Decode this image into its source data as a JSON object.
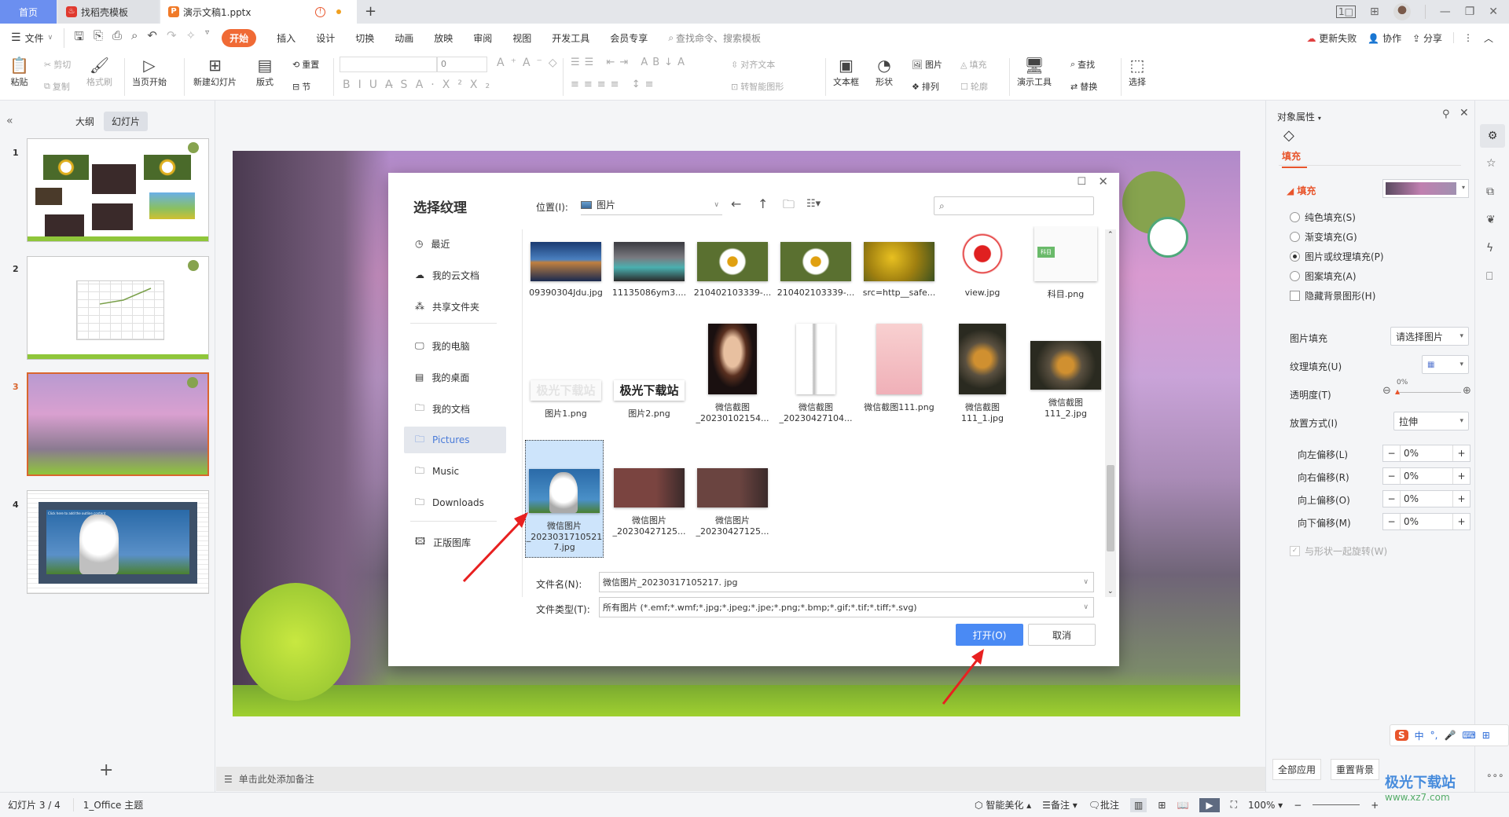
{
  "titlebar": {
    "tabs": [
      {
        "label": "首页"
      },
      {
        "label": "找稻壳模板",
        "icon": "daoke-logo-icon"
      },
      {
        "label": "演示文稿1.pptx",
        "icon": "pptx-file-icon",
        "status": "!"
      }
    ],
    "new_tab": "+",
    "win": {
      "layout": "1□",
      "grid": "⊞",
      "min": "—",
      "restore": "❐",
      "close": "✕"
    }
  },
  "menubar": {
    "file": "文件",
    "items": [
      "开始",
      "插入",
      "设计",
      "切换",
      "动画",
      "放映",
      "审阅",
      "视图",
      "开发工具",
      "会员专享"
    ],
    "search_placeholder": "查找命令、搜索模板",
    "right": {
      "update": "更新失败",
      "collab": "协作",
      "share": "分享"
    }
  },
  "ribbon": {
    "paste": "粘贴",
    "cut": "剪切",
    "copy": "复制",
    "format_painter": "格式刷",
    "from_current": "当页开始",
    "new_slide": "新建幻灯片",
    "layout": "版式",
    "reset": "重置",
    "section": "节",
    "font_size": "0",
    "align_text": "对齐文本",
    "smart_shape": "转智能图形",
    "textbox": "文本框",
    "shape": "形状",
    "picture": "图片",
    "fill": "填充",
    "arrange": "排列",
    "outline": "轮廓",
    "present_tools": "演示工具",
    "find": "查找",
    "replace": "替换",
    "select": "选择"
  },
  "leftpanel": {
    "tabs": [
      "大纲",
      "幻灯片"
    ],
    "active_tab": "幻灯片",
    "slides": [
      "1",
      "2",
      "3",
      "4"
    ],
    "selected_slide": "3",
    "slide4_caption": "Click here to add the outline content",
    "add": "+"
  },
  "dialog": {
    "title": "选择纹理",
    "location_label": "位置(I):",
    "location_value": "图片",
    "search_placeholder": "",
    "nav": [
      {
        "label": "最近",
        "icon": "clock-icon"
      },
      {
        "label": "我的云文档",
        "icon": "cloud-icon"
      },
      {
        "label": "共享文件夹",
        "icon": "share-folder-icon"
      },
      {
        "label": "我的电脑",
        "icon": "computer-icon"
      },
      {
        "label": "我的桌面",
        "icon": "desktop-icon"
      },
      {
        "label": "我的文档",
        "icon": "folder-icon"
      },
      {
        "label": "Pictures",
        "icon": "folder-icon"
      },
      {
        "label": "Music",
        "icon": "folder-icon"
      },
      {
        "label": "Downloads",
        "icon": "folder-icon"
      },
      {
        "label": "正版图库",
        "icon": "gallery-icon"
      }
    ],
    "active_nav": "Pictures",
    "files": [
      {
        "name": "09390304Jdu.jpg",
        "thumb": "bridge-night"
      },
      {
        "name": "11135086ym3....",
        "thumb": "sea-rocks"
      },
      {
        "name": "210402103339-...",
        "thumb": "daisy"
      },
      {
        "name": "210402103339-...",
        "thumb": "daisy"
      },
      {
        "name": "src=http__safe...",
        "thumb": "yellow-tree"
      },
      {
        "name": "view.jpg",
        "thumb": "red-seal"
      },
      {
        "name": "科目.png",
        "thumb": "mindmap"
      },
      {
        "name": "图片1.png",
        "thumb": "text-light"
      },
      {
        "name": "图片2.png",
        "thumb": "text-bold"
      },
      {
        "name": "微信截图 _20230102154...",
        "thumb": "portrait-woman"
      },
      {
        "name": "微信截图 _20230427104...",
        "thumb": "sketch-girl"
      },
      {
        "name": "微信截图111.png",
        "thumb": "cartoon-couple"
      },
      {
        "name": "微信截图 111_1.jpg",
        "thumb": "leaf-dark"
      },
      {
        "name": "微信截图 111_2.jpg",
        "thumb": "leaf-dark-wide"
      },
      {
        "name": "微信图片 _2023031710521 7.jpg",
        "thumb": "husky"
      },
      {
        "name": "微信图片 _20230427125...",
        "thumb": "drama-1"
      },
      {
        "name": "微信图片 _20230427125...",
        "thumb": "drama-2"
      }
    ],
    "selected_file": "微信图片_20230317105217.jpg",
    "thumb_text_light": "极光下载站",
    "thumb_text_bold": "极光下载站",
    "filename_label": "文件名(N):",
    "filename_value": "微信图片_20230317105217. jpg",
    "filetype_label": "文件类型(T):",
    "filetype_value": "所有图片 (*.emf;*.wmf;*.jpg;*.jpeg;*.jpe;*.png;*.bmp;*.gif;*.tif;*.tiff;*.svg)",
    "open": "打开(O)",
    "cancel": "取消"
  },
  "rightpanel": {
    "title": "对象属性",
    "tab": "填充",
    "section": "填充",
    "options": [
      {
        "label": "纯色填充(S)",
        "checked": false
      },
      {
        "label": "渐变填充(G)",
        "checked": false
      },
      {
        "label": "图片或纹理填充(P)",
        "checked": true
      },
      {
        "label": "图案填充(A)",
        "checked": false
      }
    ],
    "hide_bg": "隐藏背景图形(H)",
    "picture_fill_label": "图片填充",
    "picture_fill_value": "请选择图片",
    "texture_label": "纹理填充(U)",
    "transparency_label": "透明度(T)",
    "transparency_value": "0%",
    "transparency": 0,
    "placement_label": "放置方式(I)",
    "placement_value": "拉伸",
    "offsets": [
      {
        "label": "向左偏移(L)",
        "value": "0%"
      },
      {
        "label": "向右偏移(R)",
        "value": "0%"
      },
      {
        "label": "向上偏移(O)",
        "value": "0%"
      },
      {
        "label": "向下偏移(M)",
        "value": "0%"
      }
    ],
    "rotate_with_shape": "与形状一起旋转(W)",
    "apply_all": "全部应用",
    "reset_bg": "重置背景"
  },
  "notes": {
    "placeholder": "单击此处添加备注"
  },
  "statusbar": {
    "slide_info": "幻灯片 3 / 4",
    "theme": "1_Office 主题",
    "beautify": "智能美化",
    "notes": "备注",
    "comments": "批注",
    "zoom": "100%"
  },
  "watermark": {
    "brand": "极光下载站",
    "url": "www.xz7.com"
  },
  "colors": {
    "accent": "#f06a35",
    "primary_button": "#4a8af4",
    "selected_slide_border": "#d9662e",
    "tab_home": "#6b8ff0"
  }
}
